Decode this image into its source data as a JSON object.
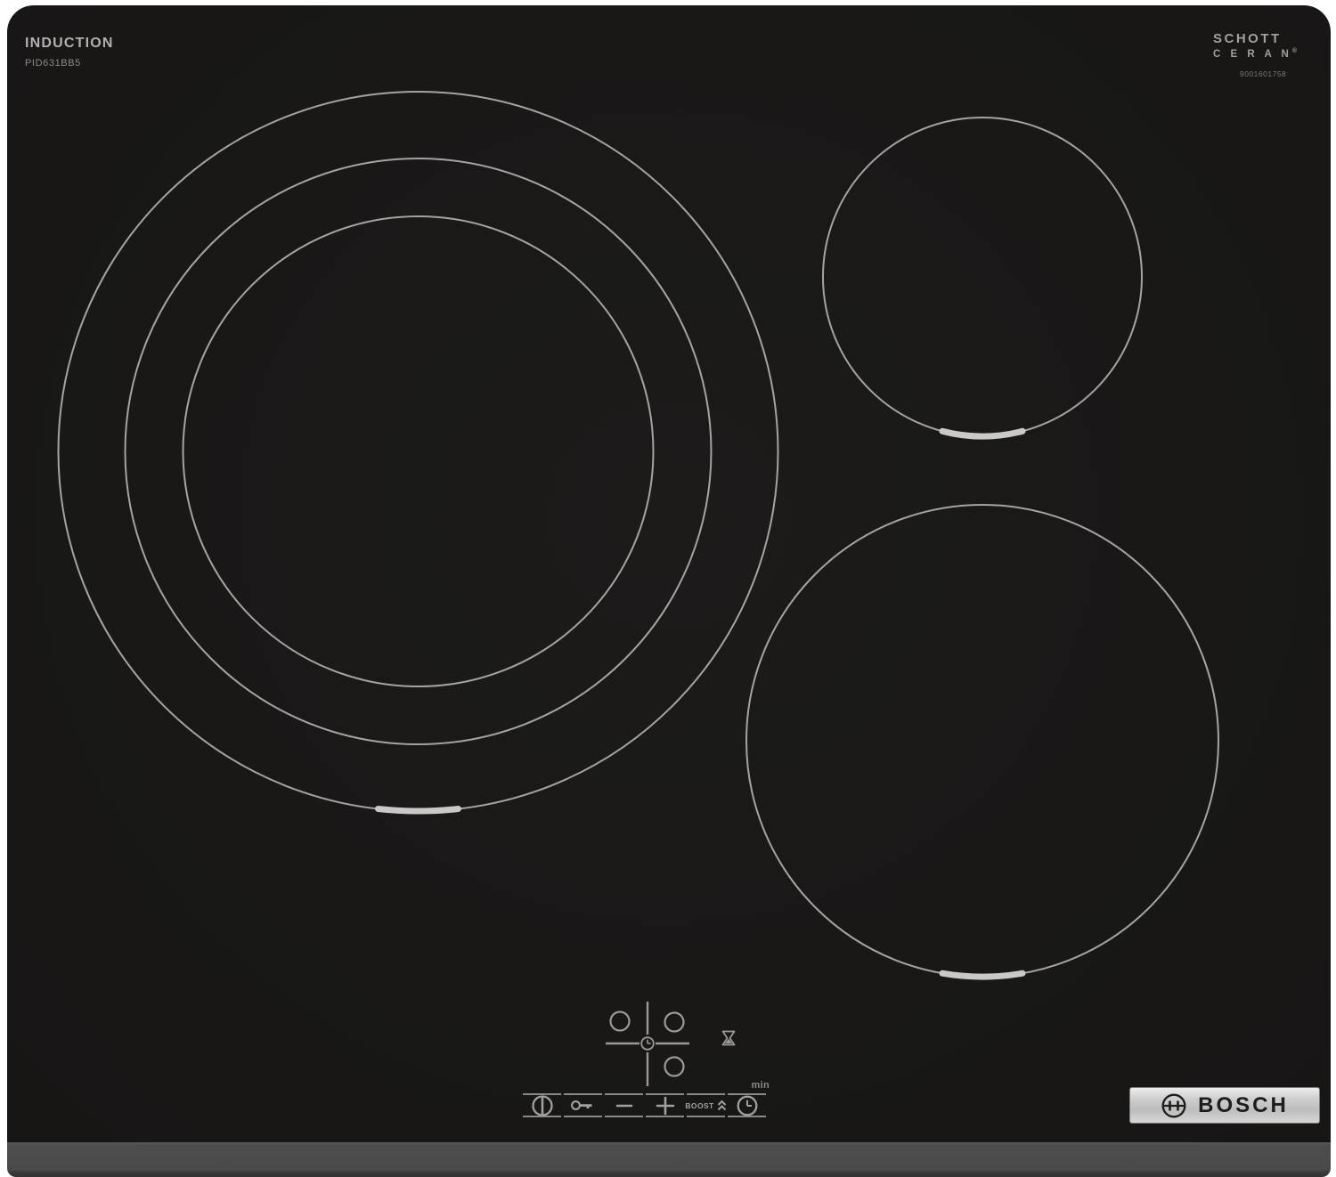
{
  "product": {
    "type_label": "INDUCTION",
    "model_number": "PID631BB5"
  },
  "glass_branding": {
    "schott_line1": "SCHOTT",
    "schott_line2": "C E R A N",
    "registered_mark": "®",
    "print_number": "9001601758"
  },
  "cooking_zones": {
    "count": 3,
    "large_left_zone": {
      "rings": 3,
      "marker": "bottom-bar"
    },
    "top_right_zone": {
      "rings": 1,
      "marker": "bottom-bar"
    },
    "bottom_right_zone": {
      "rings": 1,
      "marker": "bottom-bar"
    }
  },
  "controls": {
    "min_label": "min",
    "boost_label": "BOOST",
    "buttons": [
      {
        "id": "power",
        "icon": "power-icon"
      },
      {
        "id": "child-lock",
        "icon": "key-icon"
      },
      {
        "id": "minus",
        "icon": "minus-icon"
      },
      {
        "id": "plus",
        "icon": "plus-icon"
      },
      {
        "id": "boost",
        "icon": "boost-chevrons-icon",
        "label": "BOOST"
      },
      {
        "id": "timer",
        "icon": "clock-icon"
      }
    ],
    "zone_selector": {
      "zones_shown": 3,
      "center_icon": "clock-icon"
    },
    "status_icon": "hourglass-icon"
  },
  "badge": {
    "brand": "BOSCH"
  },
  "colors": {
    "glass": "#191817",
    "zone_line": "#a6a4a1",
    "zone_marker": "#c9c9c9",
    "control_line": "#8b8987",
    "front_trim": "#4d4d4d",
    "badge_silver": "#c9c9c9",
    "badge_text": "#1d1d1b"
  }
}
